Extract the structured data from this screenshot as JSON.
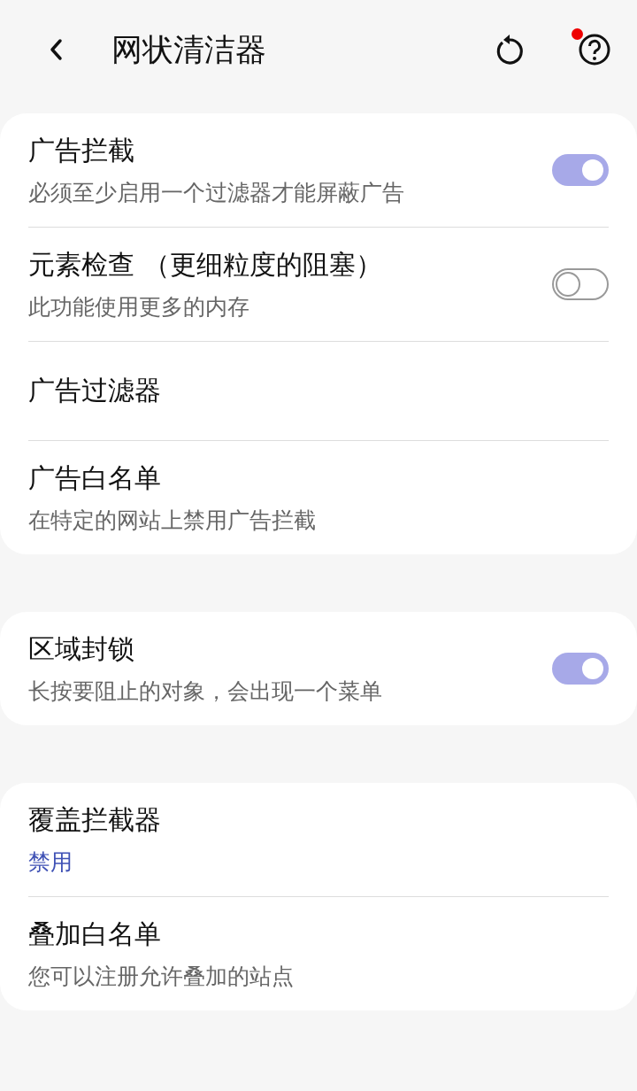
{
  "header": {
    "title": "网状清洁器",
    "help_badge": true
  },
  "cards": [
    {
      "rows": [
        {
          "kind": "toggle",
          "title": "广告拦截",
          "subtitle": "必须至少启用一个过滤器才能屏蔽广告",
          "on": true
        },
        {
          "kind": "toggle",
          "title": "元素检查 （更细粒度的阻塞）",
          "subtitle": "此功能使用更多的内存",
          "on": false
        },
        {
          "kind": "link",
          "title": "广告过滤器"
        },
        {
          "kind": "link",
          "title": "广告白名单",
          "subtitle": "在特定的网站上禁用广告拦截"
        }
      ]
    },
    {
      "rows": [
        {
          "kind": "toggle",
          "title": "区域封锁",
          "subtitle": "长按要阻止的对象，会出现一个菜单",
          "on": true
        }
      ]
    },
    {
      "rows": [
        {
          "kind": "link",
          "title": "覆盖拦截器",
          "value": "禁用"
        },
        {
          "kind": "link",
          "title": "叠加白名单",
          "subtitle": "您可以注册允许叠加的站点"
        }
      ]
    }
  ]
}
